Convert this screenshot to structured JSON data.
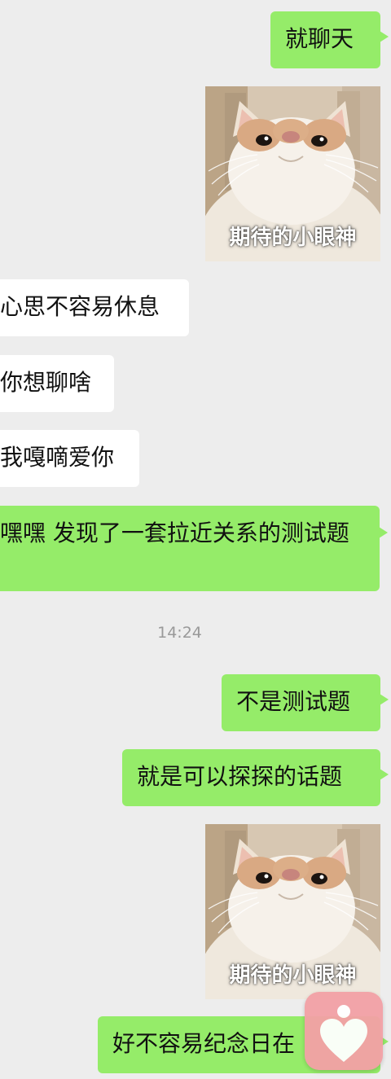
{
  "chat": {
    "messages": [
      {
        "id": "m1",
        "direction": "out",
        "type": "text",
        "text": "就聊天"
      },
      {
        "id": "m2",
        "direction": "out",
        "type": "sticker",
        "caption": "期待的小眼神"
      },
      {
        "id": "m3",
        "direction": "in",
        "type": "text",
        "text": "心思不容易休息"
      },
      {
        "id": "m4",
        "direction": "in",
        "type": "text",
        "text": "你想聊啥"
      },
      {
        "id": "m5",
        "direction": "in",
        "type": "text",
        "text": "我嘎嘀爱你"
      },
      {
        "id": "m6",
        "direction": "out",
        "type": "text",
        "text": "嘿嘿 发现了一套拉近关系的测试题"
      },
      {
        "id": "m7",
        "direction": "out",
        "type": "text",
        "text": "不是测试题"
      },
      {
        "id": "m8",
        "direction": "out",
        "type": "text",
        "text": "就是可以探探的话题"
      },
      {
        "id": "m9",
        "direction": "out",
        "type": "sticker",
        "caption": "期待的小眼神"
      },
      {
        "id": "m10",
        "direction": "out",
        "type": "text",
        "text": "好不容易纪念日在"
      }
    ],
    "timestamp": "14:24"
  },
  "colors": {
    "background": "#ededed",
    "outgoing_bubble": "#95ec69",
    "incoming_bubble": "#ffffff",
    "timestamp_text": "#999999",
    "badge": "#f3a1a6"
  },
  "icons": {
    "badge": "heart-person-icon"
  }
}
